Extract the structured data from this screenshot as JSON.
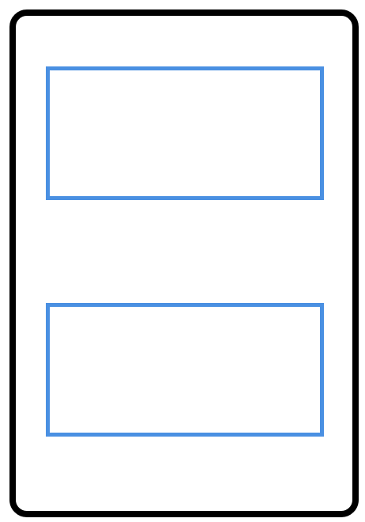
{
  "frame": {
    "border_color": "#000000",
    "background_color": "#ffffff"
  },
  "panels": [
    {
      "name": "top-panel",
      "border_color": "#4a90e2",
      "content": ""
    },
    {
      "name": "bottom-panel",
      "border_color": "#4a90e2",
      "content": ""
    }
  ]
}
